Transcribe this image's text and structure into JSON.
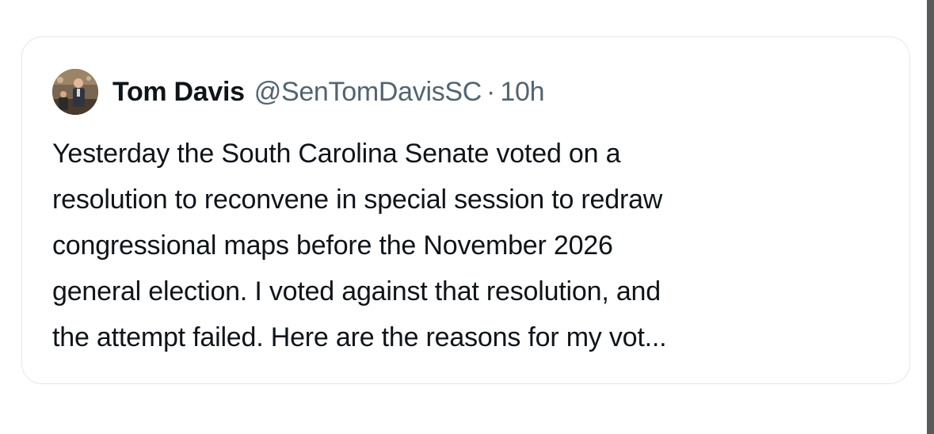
{
  "quote": {
    "author": {
      "name": "Tom Davis",
      "handle": "@SenTomDavisSC",
      "separator": "·",
      "timestamp": "10h",
      "avatar_icon": "profile-photo"
    },
    "text_lines": [
      "Yesterday the South Carolina Senate voted on a",
      "resolution to reconvene in special session to redraw",
      "congressional maps before the November 2026",
      "general election. I voted against that resolution, and",
      "the attempt failed. Here are the reasons for my vot..."
    ]
  },
  "colors": {
    "text_primary": "#0f1419",
    "text_secondary": "#536471",
    "card_border": "#e3e6e9",
    "background": "#ffffff"
  }
}
